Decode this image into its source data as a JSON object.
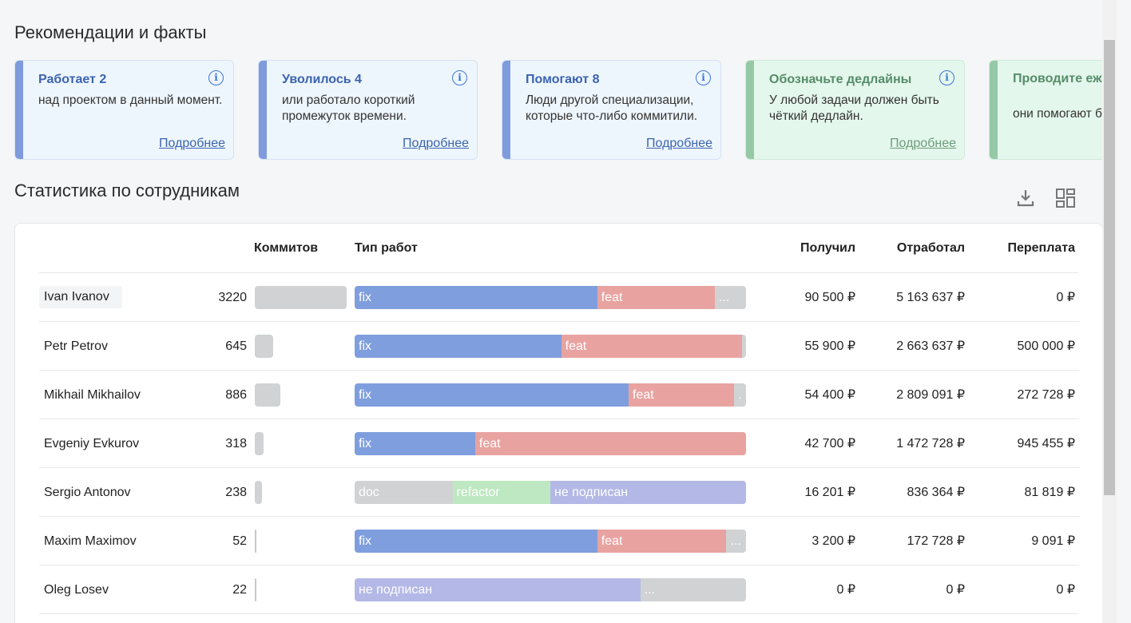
{
  "recommendations": {
    "title": "Рекомендации и факты",
    "cards": [
      {
        "title": "Работает 2",
        "text": "над проектом в данный момент.",
        "more": "Подробнее",
        "tone": "blue"
      },
      {
        "title": "Уволилось 4",
        "text": "или работало короткий промежуток времени.",
        "more": "Подробнее",
        "tone": "blue"
      },
      {
        "title": "Помогают 8",
        "text": "Люди другой специализации, которые что-либо коммитили.",
        "more": "Подробнее",
        "tone": "blue"
      },
      {
        "title": "Обозначьте дедлайны",
        "text": "У любой задачи должен быть чёткий дедлайн.",
        "more": "Подробнее",
        "tone": "green"
      },
      {
        "title": "Проводите ежед совещания",
        "text": "они помогают бы проекта.",
        "more": "",
        "tone": "green"
      }
    ]
  },
  "stats": {
    "title": "Статистика по сотрудникам",
    "columns": {
      "commits": "Коммитов",
      "type": "Тип работ",
      "received": "Получил",
      "worked": "Отработал",
      "overpay": "Переплата"
    },
    "rows": [
      {
        "name": "Ivan Ivanov",
        "commits": "3220",
        "commits_n": 3220,
        "received": "90 500 ₽",
        "worked": "5 163 637 ₽",
        "overpay": "0 ₽",
        "types": [
          {
            "label": "fix",
            "share": 0.62,
            "kind": "fix"
          },
          {
            "label": "feat",
            "share": 0.3,
            "kind": "feat"
          },
          {
            "label": "...",
            "share": 0.08,
            "kind": "other"
          }
        ]
      },
      {
        "name": "Petr Petrov",
        "commits": "645",
        "commits_n": 645,
        "received": "55 900 ₽",
        "worked": "2 663 637 ₽",
        "overpay": "500 000 ₽",
        "types": [
          {
            "label": "fix",
            "share": 0.528,
            "kind": "fix"
          },
          {
            "label": "feat",
            "share": 0.462,
            "kind": "feat"
          },
          {
            "label": "",
            "share": 0.01,
            "kind": "other"
          }
        ]
      },
      {
        "name": "Mikhail Mikhailov",
        "commits": "886",
        "commits_n": 886,
        "received": "54 400 ₽",
        "worked": "2 809 091 ₽",
        "overpay": "272 728 ₽",
        "types": [
          {
            "label": "fix",
            "share": 0.7,
            "kind": "fix"
          },
          {
            "label": "feat",
            "share": 0.27,
            "kind": "feat"
          },
          {
            "label": ".",
            "share": 0.03,
            "kind": "other"
          }
        ]
      },
      {
        "name": "Evgeniy Evkurov",
        "commits": "318",
        "commits_n": 318,
        "received": "42 700 ₽",
        "worked": "1 472 728 ₽",
        "overpay": "945 455 ₽",
        "types": [
          {
            "label": "fix",
            "share": 0.308,
            "kind": "fix"
          },
          {
            "label": "feat",
            "share": 0.692,
            "kind": "feat"
          }
        ]
      },
      {
        "name": "Sergio Antonov",
        "commits": "238",
        "commits_n": 238,
        "received": "16 201 ₽",
        "worked": "836 364 ₽",
        "overpay": "81 819 ₽",
        "types": [
          {
            "label": "doc",
            "share": 0.25,
            "kind": "other"
          },
          {
            "label": "refactor",
            "share": 0.25,
            "kind": "refactor"
          },
          {
            "label": "не подписан",
            "share": 0.5,
            "kind": "unsigned"
          }
        ]
      },
      {
        "name": "Maxim Maximov",
        "commits": "52",
        "commits_n": 52,
        "received": "3 200 ₽",
        "worked": "172 728 ₽",
        "overpay": "9 091 ₽",
        "types": [
          {
            "label": "fix",
            "share": 0.62,
            "kind": "fix"
          },
          {
            "label": "feat",
            "share": 0.33,
            "kind": "feat"
          },
          {
            "label": "...",
            "share": 0.05,
            "kind": "other"
          }
        ]
      },
      {
        "name": "Oleg Losev",
        "commits": "22",
        "commits_n": 22,
        "received": "0 ₽",
        "worked": "0 ₽",
        "overpay": "0 ₽",
        "types": [
          {
            "label": "не подписан",
            "share": 0.73,
            "kind": "unsigned"
          },
          {
            "label": "...",
            "share": 0.27,
            "kind": "other"
          }
        ]
      }
    ]
  },
  "toolbar": {
    "download_icon": "download-icon",
    "layout_icon": "layout-grid-icon"
  },
  "colors": {
    "fix": "#7f9ede",
    "feat": "#e8a3a1",
    "other": "#d0d2d4",
    "refactor": "#bde8c1",
    "unsigned": "#b3b8e6"
  }
}
